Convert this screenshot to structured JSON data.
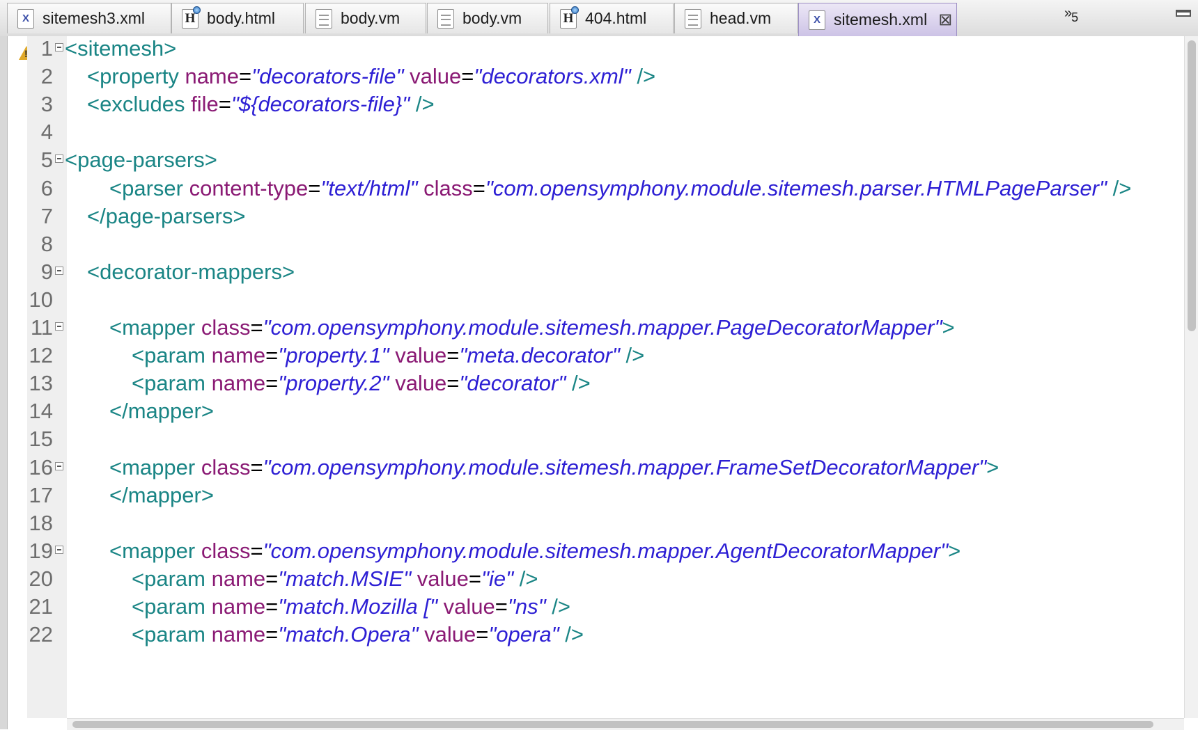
{
  "tabs": [
    {
      "label": "sitemesh3.xml",
      "icon": "xml-file-icon",
      "active": false
    },
    {
      "label": "body.html",
      "icon": "html-file-icon",
      "active": false
    },
    {
      "label": "body.vm",
      "icon": "text-file-icon",
      "active": false
    },
    {
      "label": "body.vm",
      "icon": "text-file-icon",
      "active": false
    },
    {
      "label": "404.html",
      "icon": "html-file-icon",
      "active": false
    },
    {
      "label": "head.vm",
      "icon": "text-file-icon",
      "active": false
    },
    {
      "label": "sitemesh.xml",
      "icon": "xml-file-icon",
      "active": true
    }
  ],
  "tab_close_glyph": "⊠",
  "overflow": {
    "glyph": "»",
    "count": "5"
  },
  "editor": {
    "line_numbers": [
      "1",
      "2",
      "3",
      "4",
      "5",
      "6",
      "7",
      "8",
      "9",
      "10",
      "11",
      "12",
      "13",
      "14",
      "15",
      "16",
      "17",
      "18",
      "19",
      "20",
      "21",
      "22"
    ],
    "lines": [
      "<sitemesh>",
      "<property name=\"decorators-file\" value=\"decorators.xml\" />",
      "<excludes file=\"${decorators-file}\" />",
      "",
      "<page-parsers>",
      "<parser content-type=\"text/html\" class=\"com.opensymphony.module.sitemesh.parser.HTMLPageParser\" />",
      "</page-parsers>",
      "",
      "<decorator-mappers>",
      "",
      "<mapper class=\"com.opensymphony.module.sitemesh.mapper.PageDecoratorMapper\">",
      "<param name=\"property.1\" value=\"meta.decorator\" />",
      "<param name=\"property.2\" value=\"decorator\" />",
      "</mapper>",
      "",
      "<mapper class=\"com.opensymphony.module.sitemesh.mapper.FrameSetDecoratorMapper\">",
      "</mapper>",
      "",
      "<mapper class=\"com.opensymphony.module.sitemesh.mapper.AgentDecoratorMapper\">",
      "<param name=\"match.MSIE\" value=\"ie\" />",
      "<param name=\"match.Mozilla [\" value=\"ns\" />",
      "<param name=\"match.Opera\" value=\"opera\" />"
    ]
  },
  "colors": {
    "tag": "#1a8585",
    "attribute": "#8a1a74",
    "value": "#2d1fd4",
    "active_tab": "#cdc3e6"
  }
}
